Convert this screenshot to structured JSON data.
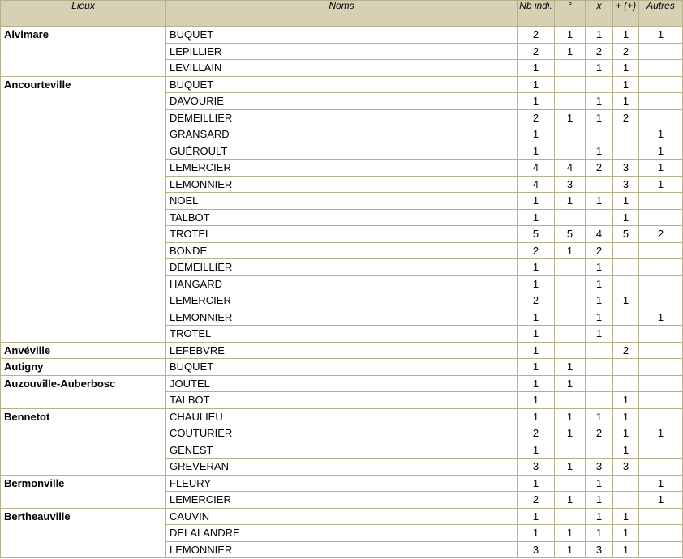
{
  "headers": {
    "lieux": "Lieux",
    "noms": "Noms",
    "nb": "Nb indi.",
    "deg": "°",
    "x": "x",
    "plus": "+ (+)",
    "autres": "Autres"
  },
  "groups": [
    {
      "place": "Alvimare",
      "rows": [
        [
          "BUQUET",
          "2",
          "1",
          "1",
          "1",
          "1"
        ],
        [
          "LEPILLIER",
          "2",
          "1",
          "2",
          "2",
          ""
        ],
        [
          "LEVILLAIN",
          "1",
          "",
          "1",
          "1",
          ""
        ]
      ]
    },
    {
      "place": "Ancourteville",
      "rows": [
        [
          "BUQUET",
          "1",
          "",
          "",
          "1",
          ""
        ],
        [
          "DAVOURIE",
          "1",
          "",
          "1",
          "1",
          ""
        ],
        [
          "DEMEILLIER",
          "2",
          "1",
          "1",
          "2",
          ""
        ],
        [
          "GRANSARD",
          "1",
          "",
          "",
          "",
          "1"
        ],
        [
          "GUÉROULT",
          "1",
          "",
          "1",
          "",
          "1"
        ],
        [
          "LEMERCIER",
          "4",
          "4",
          "2",
          "3",
          "1"
        ],
        [
          "LEMONNIER",
          "4",
          "3",
          "",
          "3",
          "1"
        ],
        [
          "NOEL",
          "1",
          "1",
          "1",
          "1",
          ""
        ],
        [
          "TALBOT",
          "1",
          "",
          "",
          "1",
          ""
        ],
        [
          "TROTEL",
          "5",
          "5",
          "4",
          "5",
          "2"
        ],
        [
          "BONDE",
          "2",
          "1",
          "2",
          "",
          ""
        ],
        [
          "DEMEILLIER",
          "1",
          "",
          "1",
          "",
          ""
        ],
        [
          "HANGARD",
          "1",
          "",
          "1",
          "",
          ""
        ],
        [
          "LEMERCIER",
          "2",
          "",
          "1",
          "1",
          ""
        ],
        [
          "LEMONNIER",
          "1",
          "",
          "1",
          "",
          "1"
        ],
        [
          "TROTEL",
          "1",
          "",
          "1",
          "",
          ""
        ]
      ]
    },
    {
      "place": "Anvéville",
      "rows": [
        [
          "LEFEBVRE",
          "1",
          "",
          "",
          "2",
          ""
        ]
      ]
    },
    {
      "place": "Autigny",
      "rows": [
        [
          "BUQUET",
          "1",
          "1",
          "",
          "",
          ""
        ]
      ]
    },
    {
      "place": "Auzouville-Auberbosc",
      "rows": [
        [
          "JOUTEL",
          "1",
          "1",
          "",
          "",
          ""
        ],
        [
          "TALBOT",
          "1",
          "",
          "",
          "1",
          ""
        ]
      ]
    },
    {
      "place": "Bennetot",
      "rows": [
        [
          "CHAULIEU",
          "1",
          "1",
          "1",
          "1",
          ""
        ],
        [
          "COUTURIER",
          "2",
          "1",
          "2",
          "1",
          "1"
        ],
        [
          "GENEST",
          "1",
          "",
          "",
          "1",
          ""
        ],
        [
          "GREVERAN",
          "3",
          "1",
          "3",
          "3",
          ""
        ]
      ]
    },
    {
      "place": "Bermonville",
      "rows": [
        [
          "FLEURY",
          "1",
          "",
          "1",
          "",
          "1"
        ],
        [
          "LEMERCIER",
          "2",
          "1",
          "1",
          "",
          "1"
        ]
      ]
    },
    {
      "place": "Bertheauville",
      "rows": [
        [
          "CAUVIN",
          "1",
          "",
          "1",
          "1",
          ""
        ],
        [
          "DELALANDRE",
          "1",
          "1",
          "1",
          "1",
          ""
        ],
        [
          "LEMONNIER",
          "3",
          "1",
          "3",
          "1",
          ""
        ]
      ]
    }
  ]
}
